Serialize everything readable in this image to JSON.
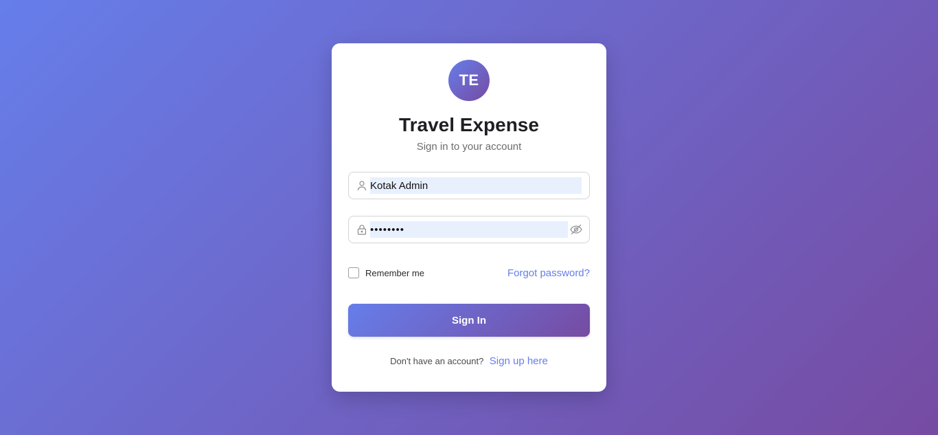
{
  "brand": {
    "logo_initials": "TE",
    "title": "Travel Expense",
    "subtitle": "Sign in to your account"
  },
  "form": {
    "username": {
      "value": "Kotak Admin",
      "icon": "user-icon"
    },
    "password": {
      "value": "••••••••",
      "icon": "lock-icon",
      "toggle_icon": "eye-off-icon"
    },
    "remember_label": "Remember me",
    "remember_checked": false,
    "forgot_label": "Forgot password?",
    "submit_label": "Sign In"
  },
  "footer": {
    "prompt": "Don't have an account?",
    "signup_label": "Sign up here"
  },
  "colors": {
    "gradient_start": "#667eea",
    "gradient_end": "#764ba2",
    "link": "#667eea",
    "autofill_bg": "#e8f0fe"
  }
}
